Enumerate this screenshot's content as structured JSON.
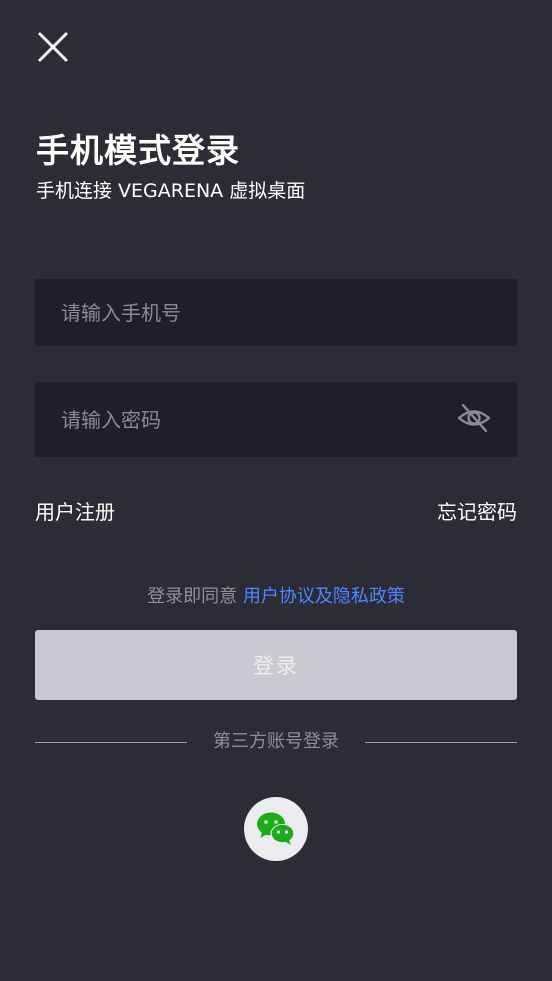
{
  "header": {
    "title": "手机模式登录",
    "subtitle": "手机连接 VEGARENA 虚拟桌面"
  },
  "form": {
    "phone_placeholder": "请输入手机号",
    "password_placeholder": "请输入密码"
  },
  "links": {
    "register": "用户注册",
    "forgot": "忘记密码"
  },
  "agreement": {
    "prefix": "登录即同意",
    "link": "用户协议及隐私政策"
  },
  "login_button": "登录",
  "third_party": {
    "label": "第三方账号登录",
    "providers": [
      "wechat-icon"
    ]
  },
  "colors": {
    "background": "#2c2c36",
    "field_background": "#1f1f29",
    "link_blue": "#4f86ff",
    "button_disabled": "#c8c9d0",
    "wechat_green": "#1aad19"
  }
}
